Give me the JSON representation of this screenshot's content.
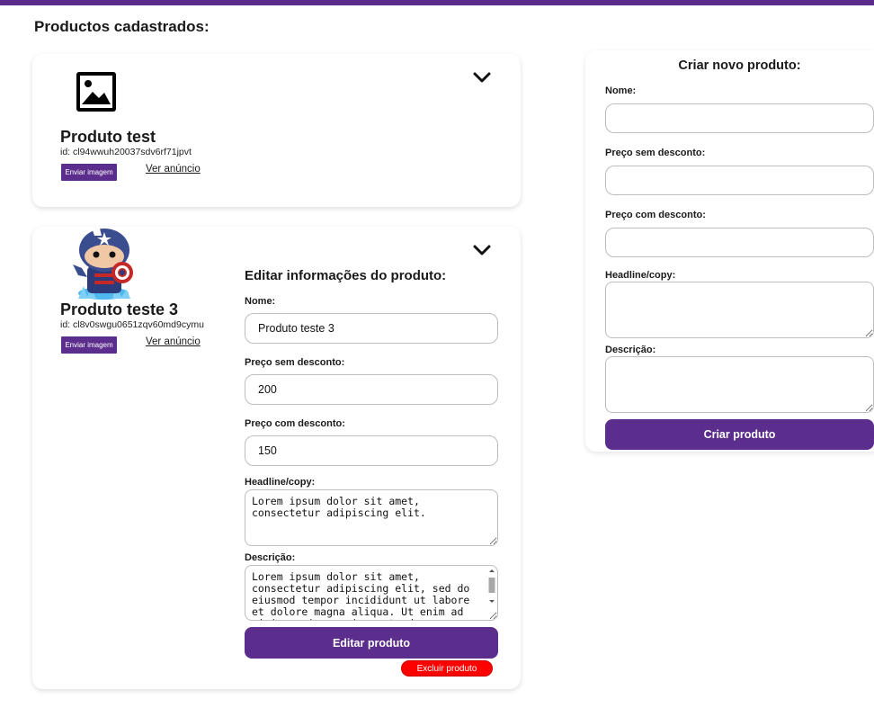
{
  "page": {
    "title": "Productos cadastrados:"
  },
  "colors": {
    "accent": "#5b2d8c",
    "danger": "#ff0000",
    "top_bar": "#5b2a8a"
  },
  "products": [
    {
      "name": "Produto test",
      "id_text": "id: cl94wwuh20037sdv6rf71jpvt",
      "upload_label": "Enviar imagem",
      "ad_link": "Ver anúncio",
      "image_icon": "image-placeholder-icon",
      "toggle_icon": "chevron-down-icon"
    },
    {
      "name": "Produto teste 3",
      "id_text": "id: cl8v0swgu0651zqv60md9cymu",
      "upload_label": "Enviar imagem",
      "ad_link": "Ver anúncio",
      "image_icon": "captain-america-figure-image",
      "toggle_icon": "chevron-up-icon"
    }
  ],
  "edit_form": {
    "heading": "Editar informações do produto:",
    "name_label": "Nome:",
    "name_value": "Produto teste 3",
    "price_label": "Preço sem desconto:",
    "price_value": "200",
    "discount_label": "Preço com desconto:",
    "discount_value": "150",
    "headline_label": "Headline/copy:",
    "headline_value": "Lorem ipsum dolor sit amet, consectetur adipiscing elit.",
    "description_label": "Descrição:",
    "description_value": "Lorem ipsum dolor sit amet, consectetur adipiscing elit, sed do eiusmod tempor incididunt ut labore et dolore magna aliqua. Ut enim ad minim veniam, quis nostrud",
    "submit_label": "Editar produto",
    "delete_label": "Excluir produto"
  },
  "create_form": {
    "heading": "Criar novo produto:",
    "name_label": "Nome:",
    "price_label": "Preço sem desconto:",
    "discount_label": "Preço com desconto:",
    "headline_label": "Headline/copy:",
    "description_label": "Descrição:",
    "submit_label": "Criar produto"
  }
}
